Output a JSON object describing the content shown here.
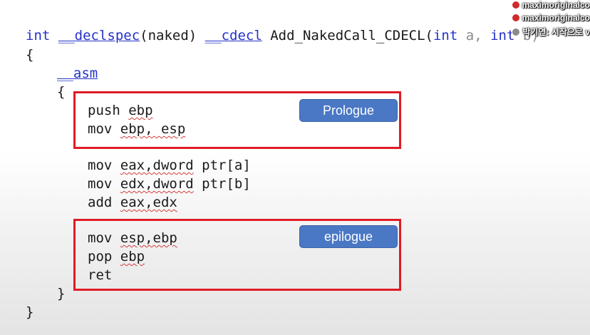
{
  "code": {
    "l1": {
      "int": "int",
      "declspec": "__declspec",
      "open": "(naked) ",
      "cdecl": "__cdecl",
      "fname": " Add_NakedCall_CDECL(",
      "int2": "int",
      "a": " a, ",
      "int3": "int",
      "b": " b)"
    },
    "l2": "{",
    "l3": "__asm",
    "l4": "{",
    "push": "push",
    "ebp1": "ebp",
    "mov": "mov",
    "ebp2": "ebp, esp",
    "mov1": "mov",
    "mov1_args": "eax,dword",
    "mov1_tail": " ptr[a]",
    "mov2": "mov",
    "mov2_args": "edx,dword",
    "mov2_tail": " ptr[b]",
    "add": "add",
    "add_args": "eax,edx",
    "mov3": "mov",
    "mov3_args": "esp,ebp",
    "pop": "pop",
    "pop_args": "ebp",
    "ret": "ret",
    "close_inner": "}",
    "close_outer": "}"
  },
  "labels": {
    "prologue": "Prologue",
    "epilogue": "epilogue"
  },
  "chat": [
    {
      "text": "maximoriginalco"
    },
    {
      "text": "maximoriginalco"
    },
    {
      "text": "박기연: 시작으로 v"
    }
  ],
  "colors": {
    "keyword": "#2431c8",
    "box": "#e01b24",
    "tag": "#4a78c5"
  }
}
